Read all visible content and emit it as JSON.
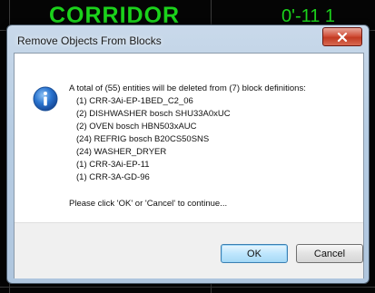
{
  "background": {
    "label_corridor": "CORRIDOR",
    "label_dimension": "0'-11 1"
  },
  "dialog": {
    "title": "Remove Objects From Blocks",
    "icon": "info-icon",
    "message_header": "A total of (55) entities will be deleted from (7) block definitions:",
    "items": [
      "(1) CRR-3Ai-EP-1BED_C2_06",
      "(2) DISHWASHER bosch SHU33A0xUC",
      "(2) OVEN bosch HBN503xAUC",
      "(24) REFRIG bosch B20CS50SNS",
      "(24) WASHER_DRYER",
      "(1) CRR-3Ai-EP-11",
      "(1) CRR-3A-GD-96"
    ],
    "prompt": "Please click 'OK' or 'Cancel' to continue...",
    "ok_label": "OK",
    "cancel_label": "Cancel"
  },
  "colors": {
    "cad_text": "#1bd21b",
    "close_button": "#c23a22",
    "ok_highlight": "#bee6fd"
  }
}
